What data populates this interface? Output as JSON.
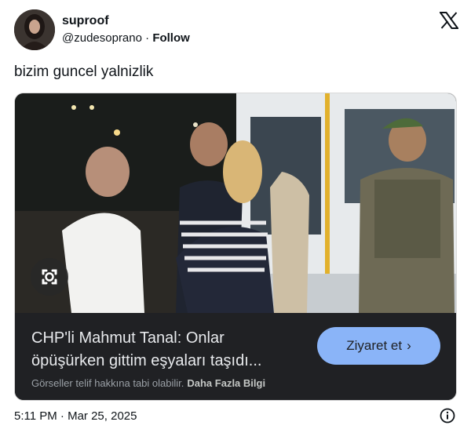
{
  "author": {
    "display_name": "suproof",
    "handle": "@zudesoprano",
    "separator": " · ",
    "follow_label": "Follow",
    "avatar_icon": "user-avatar-photo"
  },
  "tweet": {
    "text": "bizim guncel yalnizlik"
  },
  "card": {
    "headline": "CHP'li Mahmut Tanal: Onlar\nöpüşürken gittim eşyaları taşıdı...",
    "button_label": "Ziyaret et",
    "button_chevron": "›",
    "notice_text": "Görseller telif hakkına tabi olabilir.",
    "more_info_label": "Daha Fazla Bilgi",
    "lens_icon": "google-lens-icon",
    "accent_color": "#8ab4f8",
    "background_color": "#202124"
  },
  "footer": {
    "timestamp": "5:11 PM · Mar 25, 2025",
    "info_icon": "info-icon"
  }
}
